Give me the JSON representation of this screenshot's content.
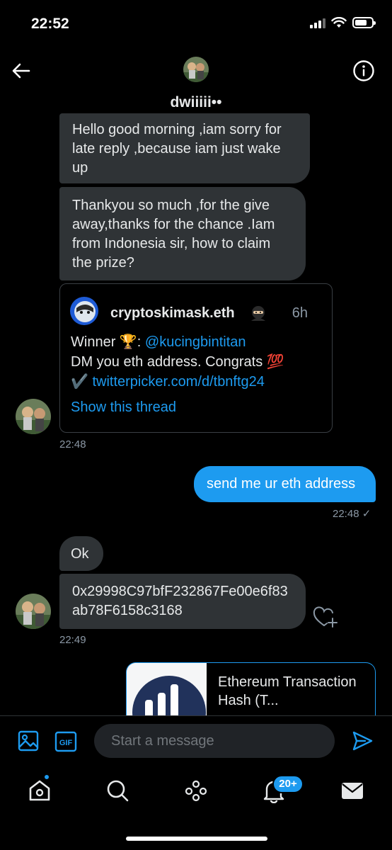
{
  "status_bar": {
    "time": "22:52"
  },
  "header": {
    "name": "dwiiiii••"
  },
  "messages": {
    "m1": "Hello good morning ,iam sorry for late reply ,because iam just wake up",
    "m2": "Thankyou so much ,for the give away,thanks for the chance .Iam from Indonesia sir, how to claim the prize?",
    "quoted_tweet": {
      "author": "cryptoskimask.eth",
      "time": "6h",
      "line1_prefix": "Winner 🏆: ",
      "mention": "@kucingbintitan",
      "line2": "DM you eth address. Congrats 💯",
      "checkmark": "✔️ ",
      "link": "twitterpicker.com/d/tbnftg24",
      "show_thread": "Show this thread"
    },
    "time1": "22:48",
    "sent": "send me ur eth address",
    "sent_time": "22:48 ✓",
    "m3": "Ok",
    "m4": "0x29998C97bfF232867Fe00e6f83ab78F6158c3168",
    "time2": "22:49",
    "link_card": {
      "title": "Ethereum Transaction Hash (T..."
    }
  },
  "composer": {
    "placeholder": "Start a message"
  },
  "tabbar": {
    "notifications_badge": "20+"
  },
  "colors": {
    "accent": "#1d9bf0",
    "bubble": "#2f3336",
    "background": "#000000"
  }
}
